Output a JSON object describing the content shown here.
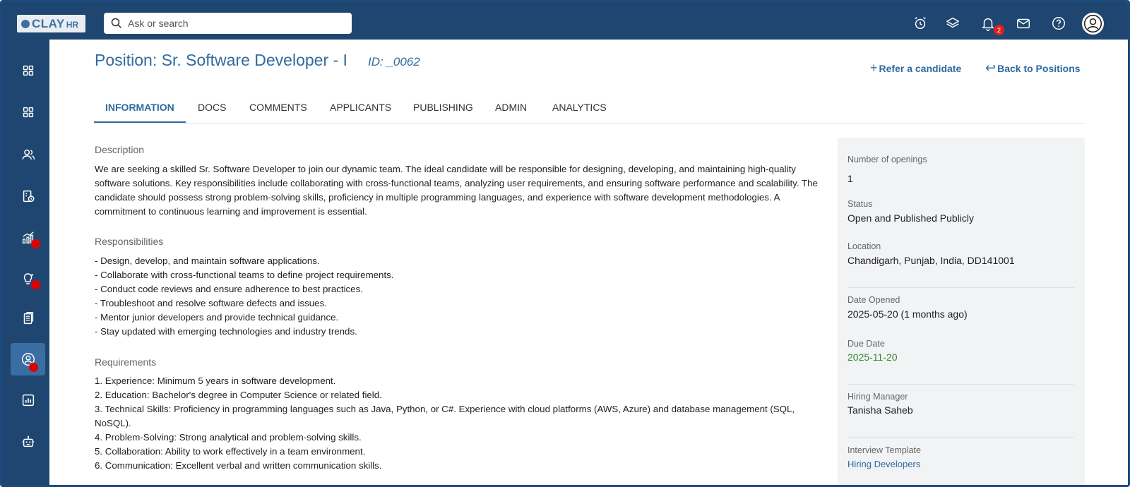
{
  "brand": {
    "logo_text": "CLAY",
    "logo_sub": "HR"
  },
  "search": {
    "placeholder": "Ask or search"
  },
  "topbar": {
    "icons": [
      "alarm-icon",
      "layers-icon",
      "bell-icon",
      "mail-icon",
      "help-icon",
      "user-avatar-icon"
    ],
    "notification_count": "2"
  },
  "sidebar": {
    "items": [
      {
        "icon": "dashboard-grid-icon"
      },
      {
        "icon": "apps-grid-icon"
      },
      {
        "icon": "people-icon"
      },
      {
        "icon": "building-clock-icon"
      },
      {
        "icon": "analytics-bars-icon",
        "badge": true
      },
      {
        "icon": "lightbulb-icon",
        "badge": true
      },
      {
        "icon": "documents-icon"
      },
      {
        "icon": "recruit-user-icon",
        "active": true,
        "badge": true
      },
      {
        "icon": "report-chart-icon"
      },
      {
        "icon": "robot-icon"
      }
    ]
  },
  "header": {
    "title": "Position: Sr. Software Developer - I",
    "id_label": "ID: _0062",
    "refer_link": "Refer a candidate",
    "back_link": "Back to Positions"
  },
  "tabs": [
    {
      "label": "INFORMATION",
      "active": true
    },
    {
      "label": "DOCS"
    },
    {
      "label": "COMMENTS"
    },
    {
      "label": "APPLICANTS"
    },
    {
      "label": "PUBLISHING"
    },
    {
      "label": "ADMIN"
    },
    {
      "label": "ANALYTICS"
    }
  ],
  "content": {
    "description_label": "Description",
    "description": "We are seeking a skilled Sr. Software Developer to join our dynamic team. The ideal candidate will be responsible for designing, developing, and maintaining high-quality software solutions. Key responsibilities include collaborating with cross-functional teams, analyzing user requirements, and ensuring software performance and scalability. The candidate should possess strong problem-solving skills, proficiency in multiple programming languages, and experience with software development methodologies. A commitment to continuous learning and improvement is essential.",
    "responsibilities_label": "Responsibilities",
    "responsibilities": [
      "- Design, develop, and maintain software applications.",
      "- Collaborate with cross-functional teams to define project requirements.",
      "- Conduct code reviews and ensure adherence to best practices.",
      "- Troubleshoot and resolve software defects and issues.",
      "- Mentor junior developers and provide technical guidance.",
      "- Stay updated with emerging technologies and industry trends."
    ],
    "requirements_label": "Requirements",
    "requirements": [
      "1. Experience: Minimum 5 years in software development.",
      "2. Education: Bachelor's degree in Computer Science or related field.",
      "3. Technical Skills: Proficiency in programming languages such as Java, Python, or C#. Experience with cloud platforms (AWS, Azure) and database management (SQL,",
      "NoSQL).",
      "4. Problem-Solving: Strong analytical and problem-solving skills.",
      "5. Collaboration: Ability to work effectively in a team environment.",
      "6. Communication: Excellent verbal and written communication skills."
    ]
  },
  "details": {
    "openings_label": "Number of openings",
    "openings_value": "1",
    "status_label": "Status",
    "status_value": "Open and Published Publicly",
    "location_label": "Location",
    "location_value": "Chandigarh, Punjab, India, DD141001",
    "date_opened_label": "Date Opened",
    "date_opened_value": "2025-05-20 (1 months ago)",
    "due_date_label": "Due Date",
    "due_date_value": "2025-11-20",
    "hiring_manager_label": "Hiring Manager",
    "hiring_manager_value": "Tanisha Saheb",
    "interview_template_label": "Interview Template",
    "interview_template_value": "Hiring Developers"
  },
  "colors": {
    "topbar_bg": "#1f4670",
    "accent": "#2f6aa0",
    "due_date_green": "#2e8a2e",
    "badge_red": "#e00000"
  }
}
